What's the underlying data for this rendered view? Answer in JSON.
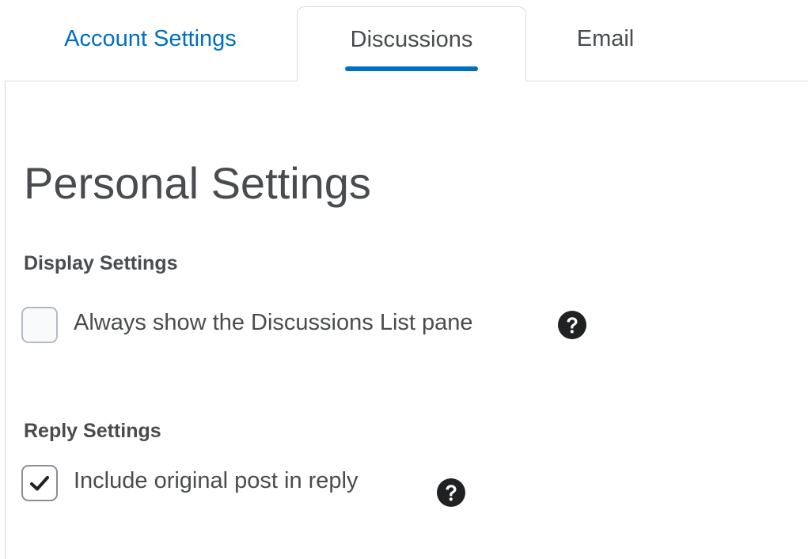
{
  "tabs": [
    {
      "label": "Account Settings",
      "selected": false
    },
    {
      "label": "Discussions",
      "selected": true
    },
    {
      "label": "Email",
      "selected": false
    }
  ],
  "page": {
    "title": "Personal Settings"
  },
  "display_settings": {
    "heading": "Display Settings",
    "option_label": "Always show the Discussions List pane",
    "checked": false,
    "help_icon": "question-circle-icon"
  },
  "reply_settings": {
    "heading": "Reply Settings",
    "option_label": "Include original post in reply",
    "checked": true,
    "help_icon": "question-circle-icon"
  },
  "colors": {
    "accent": "#006fbf",
    "text": "#494c4e",
    "border": "#d3d9e3",
    "help_icon_bg": "#202122"
  }
}
